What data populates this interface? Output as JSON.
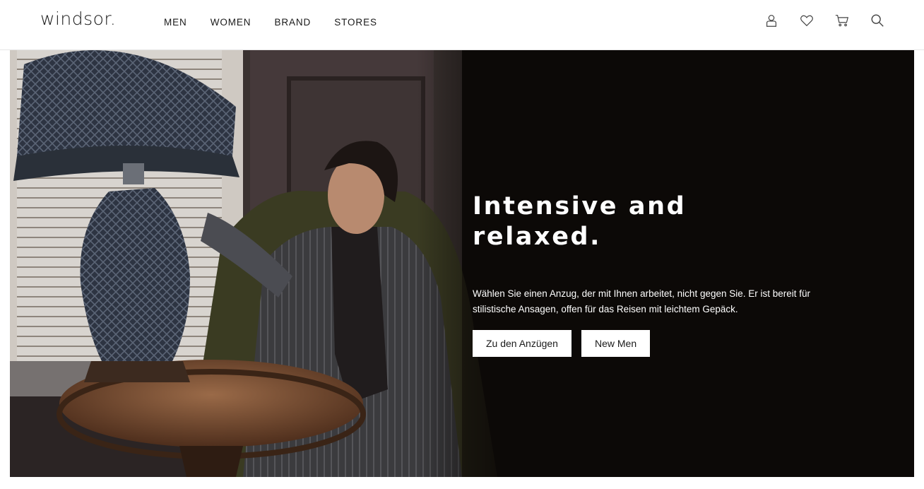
{
  "header": {
    "logo": "windsor.",
    "nav": [
      "MEN",
      "WOMEN",
      "BRAND",
      "STORES"
    ],
    "icons": [
      "account-icon",
      "wishlist-heart-icon",
      "cart-icon",
      "search-icon"
    ]
  },
  "hero": {
    "title_line1": "Intensive and",
    "title_line2": "relaxed.",
    "copy": "Wählen Sie einen Anzug, der mit Ihnen arbeitet, nicht gegen Sie. Er ist bereit für stilistische Ansagen, offen für das Reisen mit leichtem Gepäck.",
    "buttons": [
      "Zu den Anzügen",
      "New Men"
    ]
  },
  "colors": {
    "text": "#1a1a1a",
    "hero_bg": "#0c0908",
    "button_bg": "#ffffff"
  }
}
